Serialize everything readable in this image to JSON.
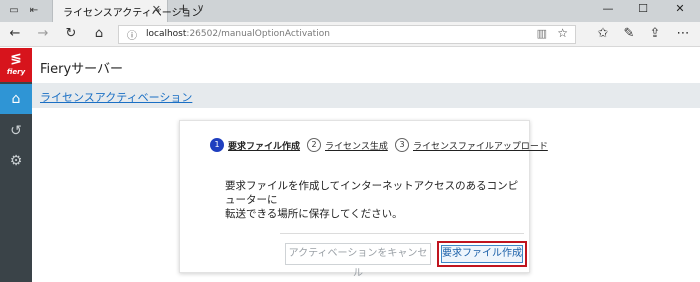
{
  "browser": {
    "tab_title": "ライセンスアクティベーション",
    "tab_close": "✕",
    "new_tab": "+",
    "tab_list": "∨",
    "window_minimize": "—",
    "window_maximize": "☐",
    "window_close": "✕",
    "url_host": "localhost",
    "url_path": ":26502/manualOptionActivation"
  },
  "app": {
    "logo_text": "fiery",
    "title": "Fieryサーバー",
    "breadcrumb": "ライセンスアクティベーション"
  },
  "wizard": {
    "steps": [
      {
        "number": "1",
        "label": "要求ファイル作成"
      },
      {
        "number": "2",
        "label": "ライセンス生成"
      },
      {
        "number": "3",
        "label": "ライセンスファイルアップロード"
      }
    ],
    "message_line1": "要求ファイルを作成してインターネットアクセスのあるコンピューターに",
    "message_line2": "転送できる場所に保存してください。",
    "cancel_label": "アクティベーションをキャンセル",
    "primary_label": "要求ファイル作成"
  },
  "colors": {
    "accent": "#2f95d5",
    "brand_red": "#d7141c",
    "step_active": "#1f3fbf",
    "link": "#1a6fc4"
  },
  "icons": {
    "sidebar": [
      "home-icon",
      "history-icon",
      "gear-icon"
    ],
    "toolbar": [
      "back-icon",
      "forward-icon",
      "refresh-icon",
      "home-icon",
      "info-icon",
      "reading-view-icon",
      "favorite-star-icon",
      "favorites-icon",
      "notes-pen-icon",
      "share-icon",
      "more-icon"
    ]
  }
}
